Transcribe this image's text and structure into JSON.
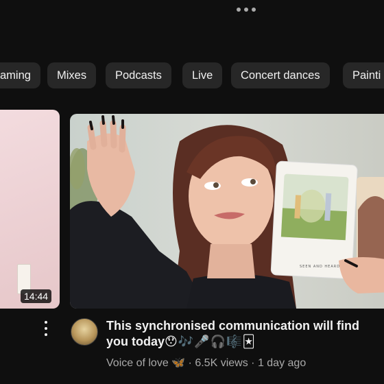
{
  "top_bar": {
    "more_icon": "more-horizontal-icon"
  },
  "chips": [
    "aming",
    "Mixes",
    "Podcasts",
    "Live",
    "Concert dances",
    "Painti"
  ],
  "left_video": {
    "duration": "14:44"
  },
  "video": {
    "title_line1": "This synchronised communication will find",
    "title_line2": "you today",
    "title_emojis": "😯🎶🎤🎧🎼🃏",
    "channel": "Voice of love 🦋",
    "views": "6.5K views",
    "age": "1 day ago",
    "separator": "·",
    "card_caption": "SEEN AND HEARD"
  }
}
